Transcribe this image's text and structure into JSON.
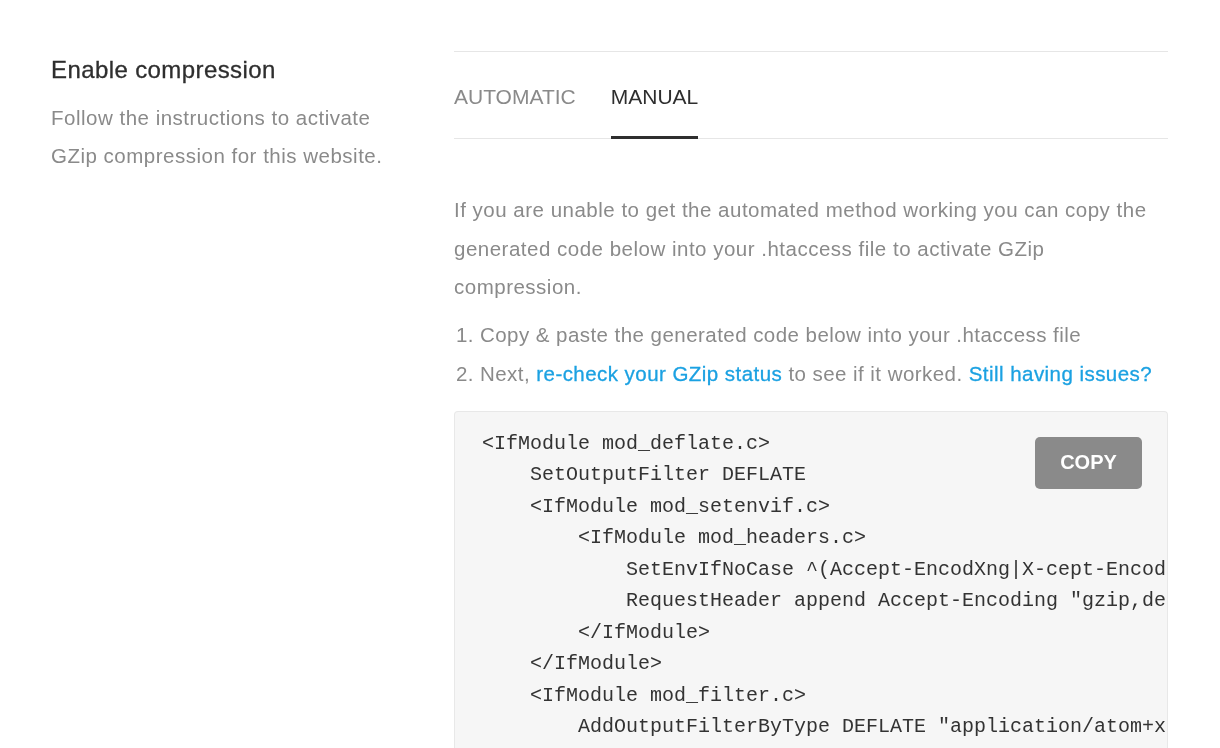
{
  "section": {
    "title": "Enable compression",
    "description": "Follow the instructions to activate GZip compression for this website."
  },
  "tabs": [
    {
      "label": "AUTOMATIC",
      "selected": false
    },
    {
      "label": "MANUAL",
      "selected": true
    }
  ],
  "manual": {
    "intro": "If you are unable to get the automated method working you can copy the generated code below into your .htaccess file to activate GZip compression.",
    "steps": [
      {
        "number": "1.",
        "parts": [
          {
            "kind": "text",
            "text": "Copy & paste the generated code below into your .htaccess file"
          }
        ]
      },
      {
        "number": "2.",
        "parts": [
          {
            "kind": "text",
            "text": "Next,"
          },
          {
            "kind": "link",
            "text": "re-check your GZip status"
          },
          {
            "kind": "text",
            "text": "to see if it worked."
          },
          {
            "kind": "link",
            "text": "Still having issues?"
          }
        ]
      }
    ],
    "code": {
      "copy_button": "COPY",
      "blocks": [
        {
          "open": "<IfModule mod_deflate.c>",
          "children": [
            {
              "text": "SetOutputFilter DEFLATE"
            },
            {
              "open": "<IfModule mod_setenvif.c>",
              "children": [
                {
                  "open": "<IfModule mod_headers.c>",
                  "children": [
                    {
                      "text": "SetEnvIfNoCase ^(Accept-EncodXng|X-cept-Encod"
                    },
                    {
                      "text": "RequestHeader append Accept-Encoding \"gzip,de"
                    }
                  ],
                  "close": "</IfModule>"
                }
              ],
              "close": "</IfModule>"
            },
            {
              "open": "<IfModule mod_filter.c>",
              "children": [
                {
                  "text": "AddOutputFilterByType DEFLATE \"application/atom+x"
                }
              ]
            }
          ]
        }
      ]
    }
  }
}
